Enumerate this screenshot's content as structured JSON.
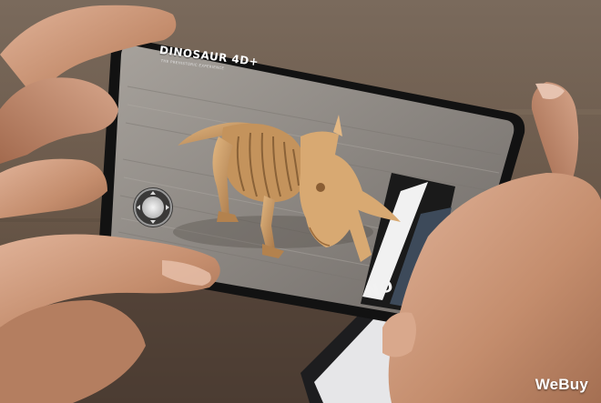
{
  "app": {
    "title": "DINOSAUR 4D+",
    "subtitle": "THE PREHISTORIC EXPERIENCE"
  },
  "side_card": {
    "text": "NO"
  },
  "watermark": {
    "text": "WeBuy"
  },
  "icons": {
    "joystick": "joystick-control-icon"
  },
  "colors": {
    "background_wood": "#6b5a4c",
    "floor_wood": "#8f8b86",
    "skeleton": "#c99a62",
    "phone_body": "#141414",
    "skin": "#c58f6f"
  }
}
